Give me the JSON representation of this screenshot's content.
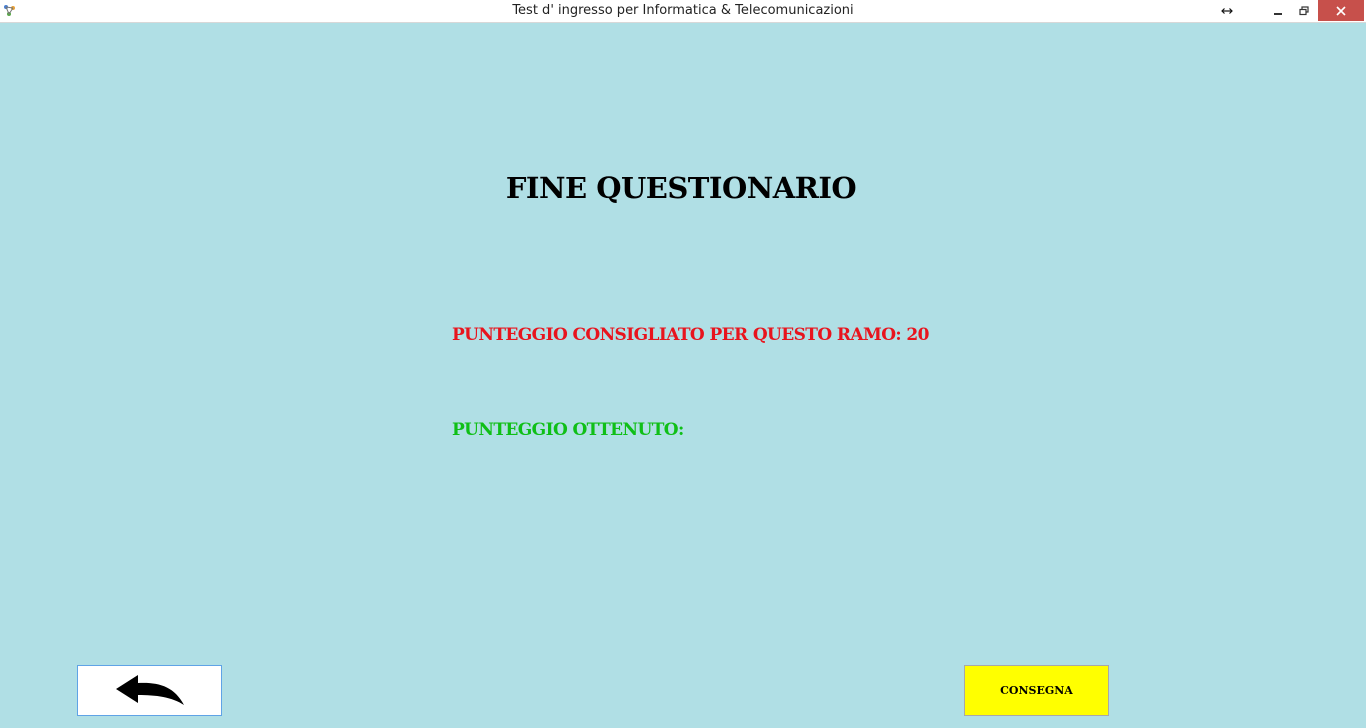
{
  "window": {
    "title": "Test d' ingresso per Informatica & Telecomunicazioni",
    "controls": {
      "resize_icon": "horizontal-resize-arrows",
      "minimize_icon": "minimize",
      "maximize_icon": "restore",
      "close_icon": "close"
    },
    "close_color": "#c7504b"
  },
  "main": {
    "heading": "FINE QUESTIONARIO",
    "recommended_score_label": "PUNTEGGIO CONSIGLIATO PER QUESTO RAMO: 20",
    "obtained_score_label": "PUNTEGGIO OTTENUTO:",
    "obtained_score_value": ""
  },
  "footer": {
    "back_icon": "back-arrow",
    "submit_label": "CONSEGNA"
  },
  "colors": {
    "background": "#b0dfe5",
    "recommended_text": "#e8141d",
    "obtained_text": "#0fbf17",
    "submit_button": "#ffff00"
  }
}
